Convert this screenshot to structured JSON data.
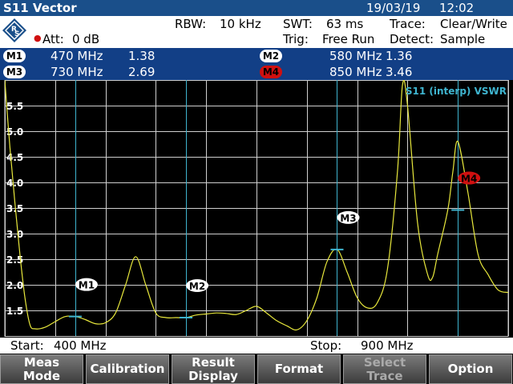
{
  "title_bar": {
    "title": "S11 Vector",
    "date": "19/03/19",
    "time": "12:02"
  },
  "settings": {
    "rbw_label": "RBW:",
    "rbw_value": "10 kHz",
    "swt_label": "SWT:",
    "swt_value": "63 ms",
    "trace_label": "Trace:",
    "trace_value": "Clear/Write",
    "att_label": "Att:",
    "att_value": "0 dB",
    "trig_label": "Trig:",
    "trig_value": "Free Run",
    "detect_label": "Detect:",
    "detect_value": "Sample"
  },
  "markers": [
    {
      "name": "M1",
      "freq": "470 MHz",
      "value": "1.38"
    },
    {
      "name": "M2",
      "freq": "580 MHz",
      "value": "1.36"
    },
    {
      "name": "M3",
      "freq": "730 MHz",
      "value": "2.69"
    },
    {
      "name": "M4",
      "freq": "850 MHz",
      "value": "3.46",
      "active": true
    }
  ],
  "plot": {
    "trace_label": "S11 (interp) VSWR",
    "y_ticks": [
      "5.5",
      "5.0",
      "4.5",
      "4.0",
      "3.5",
      "3.0",
      "2.5",
      "2.0",
      "1.5"
    ]
  },
  "footer": {
    "start_label": "Start:",
    "start_value": "400 MHz",
    "stop_label": "Stop:",
    "stop_value": "900 MHz"
  },
  "softkeys": [
    {
      "label": "Meas\nMode",
      "enabled": true
    },
    {
      "label": "Calibration",
      "enabled": true
    },
    {
      "label": "Result\nDisplay",
      "enabled": true
    },
    {
      "label": "Format",
      "enabled": true
    },
    {
      "label": "Select\nTrace",
      "enabled": false
    },
    {
      "label": "Option",
      "enabled": true
    }
  ],
  "colors": {
    "title_bar": "#1a4f8a",
    "marker_bar": "#123f86",
    "trace": "#e8e83c",
    "grid": "#cfcfcf",
    "marker_line": "#3fb5d0",
    "active_marker": "#d01010"
  },
  "chart_data": {
    "type": "line",
    "x": [
      400,
      405,
      410,
      415,
      420,
      425,
      430,
      440,
      450,
      460,
      470,
      480,
      490,
      500,
      510,
      520,
      530,
      540,
      550,
      560,
      570,
      580,
      590,
      600,
      610,
      620,
      630,
      640,
      650,
      660,
      670,
      680,
      690,
      700,
      710,
      720,
      730,
      740,
      750,
      760,
      770,
      780,
      790,
      795,
      800,
      810,
      820,
      825,
      830,
      840,
      845,
      850,
      860,
      870,
      880,
      890,
      900
    ],
    "y": [
      6.0,
      4.7,
      3.6,
      2.6,
      1.75,
      1.22,
      1.14,
      1.17,
      1.28,
      1.38,
      1.38,
      1.32,
      1.24,
      1.26,
      1.45,
      2.0,
      2.55,
      2.0,
      1.45,
      1.36,
      1.36,
      1.36,
      1.41,
      1.43,
      1.45,
      1.44,
      1.42,
      1.5,
      1.58,
      1.45,
      1.3,
      1.2,
      1.12,
      1.3,
      1.75,
      2.45,
      2.69,
      2.25,
      1.75,
      1.55,
      1.65,
      2.3,
      4.2,
      5.9,
      5.5,
      3.2,
      2.2,
      2.15,
      2.6,
      3.46,
      4.2,
      4.8,
      3.8,
      2.6,
      2.2,
      1.9,
      1.85
    ],
    "xlim": [
      400,
      900
    ],
    "ylim": [
      1.0,
      6.0
    ],
    "markers": [
      {
        "name": "M1",
        "x": 470,
        "y": 1.38
      },
      {
        "name": "M2",
        "x": 580,
        "y": 1.36
      },
      {
        "name": "M3",
        "x": 730,
        "y": 2.69
      },
      {
        "name": "M4",
        "x": 850,
        "y": 3.46
      }
    ]
  }
}
